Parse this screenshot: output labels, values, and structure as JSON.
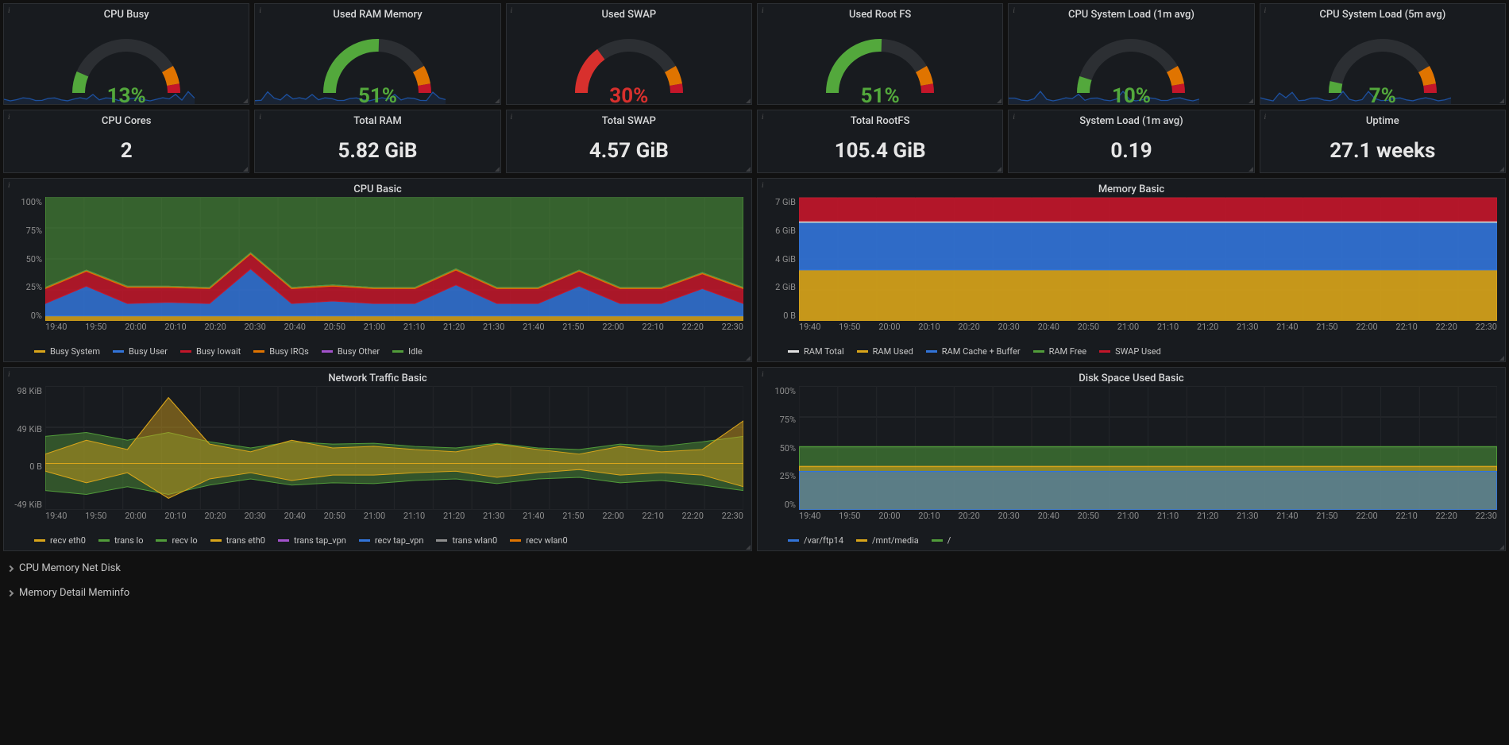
{
  "gauges": [
    {
      "title": "CPU Busy",
      "value_text": "13%",
      "value": 13,
      "color": "#53a83c",
      "sparkline": true,
      "spark_color": "#1f60c4"
    },
    {
      "title": "Used RAM Memory",
      "value_text": "51%",
      "value": 51,
      "color": "#53a83c",
      "sparkline": true,
      "spark_color": "#1f60c4"
    },
    {
      "title": "Used SWAP",
      "value_text": "30%",
      "value": 30,
      "color": "#d8302d",
      "sparkline": false,
      "spark_color": "#d8302d"
    },
    {
      "title": "Used Root FS",
      "value_text": "51%",
      "value": 51,
      "color": "#53a83c",
      "sparkline": false,
      "spark_color": "#53a83c"
    },
    {
      "title": "CPU System Load (1m avg)",
      "value_text": "10%",
      "value": 10,
      "color": "#53a83c",
      "sparkline": true,
      "spark_color": "#1f60c4"
    },
    {
      "title": "CPU System Load (5m avg)",
      "value_text": "7%",
      "value": 7,
      "color": "#53a83c",
      "sparkline": true,
      "spark_color": "#1f60c4"
    }
  ],
  "stats": [
    {
      "title": "CPU Cores",
      "value": "2"
    },
    {
      "title": "Total RAM",
      "value": "5.82 GiB"
    },
    {
      "title": "Total SWAP",
      "value": "4.57 GiB"
    },
    {
      "title": "Total RootFS",
      "value": "105.4 GiB"
    },
    {
      "title": "System Load (1m avg)",
      "value": "0.19"
    },
    {
      "title": "Uptime",
      "value": "27.1 weeks"
    }
  ],
  "cpu_basic": {
    "title": "CPU Basic",
    "ylabels": [
      "100%",
      "75%",
      "50%",
      "25%",
      "0%"
    ],
    "legend": [
      {
        "label": "Busy System",
        "color": "#d9a51a"
      },
      {
        "label": "Busy User",
        "color": "#3274d9"
      },
      {
        "label": "Busy Iowait",
        "color": "#c4162a"
      },
      {
        "label": "Busy IRQs",
        "color": "#e07400"
      },
      {
        "label": "Busy Other",
        "color": "#a352cc"
      },
      {
        "label": "Idle",
        "color": "#519c3a"
      }
    ]
  },
  "memory_basic": {
    "title": "Memory Basic",
    "ylabels": [
      "7 GiB",
      "6 GiB",
      "4 GiB",
      "2 GiB",
      "0 B"
    ],
    "legend": [
      {
        "label": "RAM Total",
        "color": "#e1e1e1"
      },
      {
        "label": "RAM Used",
        "color": "#d9a51a"
      },
      {
        "label": "RAM Cache + Buffer",
        "color": "#3274d9"
      },
      {
        "label": "RAM Free",
        "color": "#519c3a"
      },
      {
        "label": "SWAP Used",
        "color": "#c4162a"
      }
    ]
  },
  "network_basic": {
    "title": "Network Traffic Basic",
    "ylabels": [
      "98 KiB",
      "49 KiB",
      "0 B",
      "-49 KiB"
    ],
    "legend": [
      {
        "label": "recv eth0",
        "color": "#d9a51a"
      },
      {
        "label": "trans lo",
        "color": "#519c3a"
      },
      {
        "label": "recv lo",
        "color": "#519c3a"
      },
      {
        "label": "trans eth0",
        "color": "#d9a51a"
      },
      {
        "label": "trans tap_vpn",
        "color": "#a352cc"
      },
      {
        "label": "recv tap_vpn",
        "color": "#3274d9"
      },
      {
        "label": "trans wlan0",
        "color": "#8e8e8e"
      },
      {
        "label": "recv wlan0",
        "color": "#e07400"
      }
    ]
  },
  "disk_basic": {
    "title": "Disk Space Used Basic",
    "ylabels": [
      "100%",
      "75%",
      "50%",
      "25%",
      "0%"
    ],
    "legend": [
      {
        "label": "/var/ftp14",
        "color": "#3274d9"
      },
      {
        "label": "/mnt/media",
        "color": "#d9a51a"
      },
      {
        "label": "/",
        "color": "#519c3a"
      }
    ]
  },
  "xaxis_ticks": [
    "19:40",
    "19:50",
    "20:00",
    "20:10",
    "20:20",
    "20:30",
    "20:40",
    "20:50",
    "21:00",
    "21:10",
    "21:20",
    "21:30",
    "21:40",
    "21:50",
    "22:00",
    "22:10",
    "22:20",
    "22:30"
  ],
  "collapse_rows": [
    "CPU Memory Net Disk",
    "Memory Detail Meminfo"
  ],
  "chart_data": [
    {
      "type": "line",
      "title": "CPU Basic",
      "xlabel": "",
      "ylabel": "",
      "ylim": [
        0,
        100
      ],
      "x": [
        "19:40",
        "19:50",
        "20:00",
        "20:10",
        "20:20",
        "20:30",
        "20:40",
        "20:50",
        "21:00",
        "21:10",
        "21:20",
        "21:30",
        "21:40",
        "21:50",
        "22:00",
        "22:10",
        "22:20",
        "22:30"
      ],
      "series": [
        {
          "name": "Busy System",
          "values": [
            4,
            4,
            4,
            4,
            4,
            4,
            4,
            4,
            4,
            4,
            4,
            4,
            4,
            4,
            4,
            4,
            4,
            4
          ]
        },
        {
          "name": "Busy User",
          "values": [
            10,
            24,
            10,
            11,
            10,
            38,
            10,
            12,
            10,
            10,
            25,
            10,
            10,
            24,
            10,
            10,
            22,
            10
          ]
        },
        {
          "name": "Busy Iowait",
          "values": [
            12,
            12,
            13,
            12,
            12,
            12,
            12,
            12,
            12,
            12,
            12,
            12,
            12,
            12,
            12,
            12,
            12,
            12
          ]
        },
        {
          "name": "Busy IRQs",
          "values": [
            1,
            1,
            1,
            1,
            1,
            1,
            1,
            1,
            1,
            1,
            1,
            1,
            1,
            1,
            1,
            1,
            1,
            1
          ]
        },
        {
          "name": "Busy Other",
          "values": [
            0,
            0,
            0,
            0,
            0,
            0,
            0,
            0,
            0,
            0,
            0,
            0,
            0,
            0,
            0,
            0,
            0,
            0
          ]
        },
        {
          "name": "Idle",
          "values": [
            86,
            72,
            86,
            85,
            86,
            60,
            86,
            84,
            86,
            86,
            74,
            86,
            86,
            74,
            86,
            86,
            76,
            86
          ]
        }
      ]
    },
    {
      "type": "area",
      "title": "Memory Basic",
      "xlabel": "",
      "ylabel": "",
      "ylim": [
        0,
        7
      ],
      "x": [
        "19:40",
        "19:50",
        "20:00",
        "20:10",
        "20:20",
        "20:30",
        "20:40",
        "20:50",
        "21:00",
        "21:10",
        "21:20",
        "21:30",
        "21:40",
        "21:50",
        "22:00",
        "22:10",
        "22:20",
        "22:30"
      ],
      "series": [
        {
          "name": "RAM Used",
          "unit": "GiB",
          "values": [
            3.0,
            3.0,
            3.0,
            3.0,
            3.0,
            3.0,
            3.0,
            3.0,
            3.0,
            3.0,
            3.0,
            3.0,
            3.0,
            3.0,
            3.0,
            3.0,
            3.0,
            3.0
          ]
        },
        {
          "name": "RAM Cache + Buffer",
          "unit": "GiB",
          "values": [
            2.8,
            2.8,
            2.8,
            2.8,
            2.8,
            2.8,
            2.8,
            2.8,
            2.8,
            2.8,
            2.8,
            2.8,
            2.8,
            2.8,
            2.8,
            2.8,
            2.8,
            2.8
          ]
        },
        {
          "name": "RAM Free",
          "unit": "GiB",
          "values": [
            0.05,
            0.05,
            0.05,
            0.05,
            0.05,
            0.05,
            0.05,
            0.05,
            0.05,
            0.05,
            0.05,
            0.05,
            0.05,
            0.05,
            0.05,
            0.05,
            0.05,
            0.05
          ]
        },
        {
          "name": "SWAP Used",
          "unit": "GiB",
          "values": [
            1.4,
            1.4,
            1.4,
            1.4,
            1.4,
            1.4,
            1.4,
            1.4,
            1.4,
            1.4,
            1.4,
            1.4,
            1.4,
            1.4,
            1.4,
            1.4,
            1.4,
            1.4
          ]
        },
        {
          "name": "RAM Total",
          "unit": "GiB",
          "values": [
            5.82,
            5.82,
            5.82,
            5.82,
            5.82,
            5.82,
            5.82,
            5.82,
            5.82,
            5.82,
            5.82,
            5.82,
            5.82,
            5.82,
            5.82,
            5.82,
            5.82,
            5.82
          ]
        }
      ]
    },
    {
      "type": "area",
      "title": "Network Traffic Basic",
      "xlabel": "",
      "ylabel": "KiB",
      "ylim": [
        -49,
        98
      ],
      "x": [
        "19:40",
        "19:50",
        "20:00",
        "20:10",
        "20:20",
        "20:30",
        "20:40",
        "20:50",
        "21:00",
        "21:10",
        "21:20",
        "21:30",
        "21:40",
        "21:50",
        "22:00",
        "22:10",
        "22:20",
        "22:30"
      ],
      "series": [
        {
          "name": "recv eth0",
          "values": [
            12,
            30,
            18,
            85,
            25,
            15,
            30,
            20,
            22,
            18,
            15,
            25,
            18,
            12,
            22,
            15,
            18,
            55
          ]
        },
        {
          "name": "recv lo",
          "values": [
            35,
            40,
            30,
            40,
            28,
            20,
            28,
            25,
            26,
            22,
            20,
            26,
            20,
            18,
            25,
            22,
            28,
            35
          ]
        },
        {
          "name": "trans eth0",
          "values": [
            -10,
            -25,
            -12,
            -45,
            -20,
            -12,
            -22,
            -15,
            -15,
            -12,
            -10,
            -18,
            -12,
            -8,
            -15,
            -12,
            -15,
            -30
          ]
        },
        {
          "name": "trans lo",
          "values": [
            -35,
            -40,
            -30,
            -40,
            -28,
            -20,
            -28,
            -25,
            -26,
            -22,
            -20,
            -26,
            -20,
            -18,
            -25,
            -22,
            -28,
            -35
          ]
        },
        {
          "name": "trans tap_vpn",
          "values": [
            0,
            0,
            0,
            0,
            0,
            0,
            0,
            0,
            0,
            0,
            0,
            0,
            0,
            0,
            0,
            0,
            0,
            0
          ]
        },
        {
          "name": "recv tap_vpn",
          "values": [
            0,
            0,
            0,
            0,
            0,
            0,
            0,
            0,
            0,
            0,
            0,
            0,
            0,
            0,
            0,
            0,
            0,
            0
          ]
        },
        {
          "name": "trans wlan0",
          "values": [
            0,
            0,
            0,
            0,
            0,
            0,
            0,
            0,
            0,
            0,
            0,
            0,
            0,
            0,
            0,
            0,
            0,
            0
          ]
        },
        {
          "name": "recv wlan0",
          "values": [
            0,
            0,
            0,
            0,
            0,
            0,
            0,
            0,
            0,
            0,
            0,
            0,
            0,
            0,
            0,
            0,
            0,
            0
          ]
        }
      ]
    },
    {
      "type": "area",
      "title": "Disk Space Used Basic",
      "xlabel": "",
      "ylabel": "%",
      "ylim": [
        0,
        100
      ],
      "x": [
        "19:40",
        "19:50",
        "20:00",
        "20:10",
        "20:20",
        "20:30",
        "20:40",
        "20:50",
        "21:00",
        "21:10",
        "21:20",
        "21:30",
        "21:40",
        "21:50",
        "22:00",
        "22:10",
        "22:20",
        "22:30"
      ],
      "series": [
        {
          "name": "/var/ftp14",
          "values": [
            31,
            31,
            31,
            31,
            31,
            31,
            31,
            31,
            31,
            31,
            31,
            31,
            31,
            31,
            31,
            31,
            31,
            31
          ]
        },
        {
          "name": "/mnt/media",
          "values": [
            35,
            35,
            35,
            35,
            35,
            35,
            35,
            35,
            35,
            35,
            35,
            35,
            35,
            35,
            35,
            35,
            35,
            35
          ]
        },
        {
          "name": "/",
          "values": [
            51,
            51,
            51,
            51,
            51,
            51,
            51,
            51,
            51,
            51,
            51,
            51,
            51,
            51,
            51,
            51,
            51,
            51
          ]
        }
      ]
    }
  ]
}
